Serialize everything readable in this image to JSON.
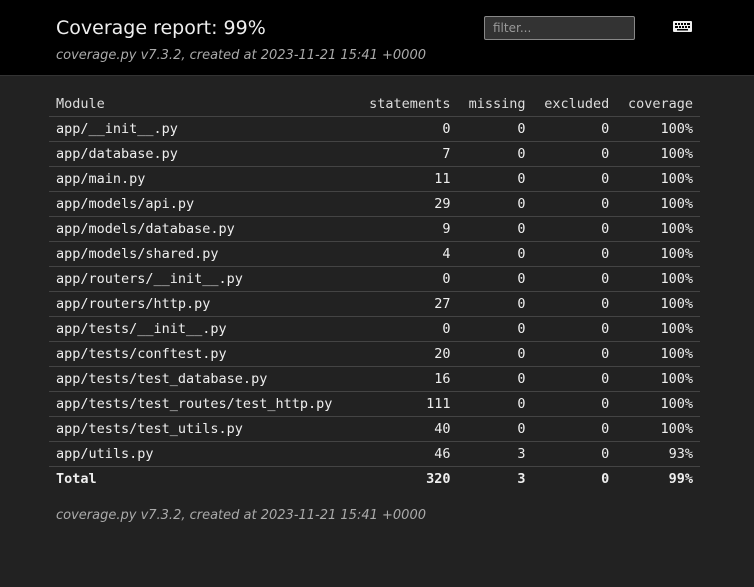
{
  "header": {
    "title": "Coverage report: 99%",
    "created": "coverage.py v7.3.2, created at 2023-11-21 15:41 +0000",
    "filter_placeholder": "filter...",
    "keyboard_icon": "keyboard-icon"
  },
  "table": {
    "columns": {
      "module": "Module",
      "statements": "statements",
      "missing": "missing",
      "excluded": "excluded",
      "coverage": "coverage"
    },
    "rows": [
      {
        "name": "app/__init__.py",
        "statements": "0",
        "missing": "0",
        "excluded": "0",
        "coverage": "100%"
      },
      {
        "name": "app/database.py",
        "statements": "7",
        "missing": "0",
        "excluded": "0",
        "coverage": "100%"
      },
      {
        "name": "app/main.py",
        "statements": "11",
        "missing": "0",
        "excluded": "0",
        "coverage": "100%"
      },
      {
        "name": "app/models/api.py",
        "statements": "29",
        "missing": "0",
        "excluded": "0",
        "coverage": "100%"
      },
      {
        "name": "app/models/database.py",
        "statements": "9",
        "missing": "0",
        "excluded": "0",
        "coverage": "100%"
      },
      {
        "name": "app/models/shared.py",
        "statements": "4",
        "missing": "0",
        "excluded": "0",
        "coverage": "100%"
      },
      {
        "name": "app/routers/__init__.py",
        "statements": "0",
        "missing": "0",
        "excluded": "0",
        "coverage": "100%"
      },
      {
        "name": "app/routers/http.py",
        "statements": "27",
        "missing": "0",
        "excluded": "0",
        "coverage": "100%"
      },
      {
        "name": "app/tests/__init__.py",
        "statements": "0",
        "missing": "0",
        "excluded": "0",
        "coverage": "100%"
      },
      {
        "name": "app/tests/conftest.py",
        "statements": "20",
        "missing": "0",
        "excluded": "0",
        "coverage": "100%"
      },
      {
        "name": "app/tests/test_database.py",
        "statements": "16",
        "missing": "0",
        "excluded": "0",
        "coverage": "100%"
      },
      {
        "name": "app/tests/test_routes/test_http.py",
        "statements": "111",
        "missing": "0",
        "excluded": "0",
        "coverage": "100%"
      },
      {
        "name": "app/tests/test_utils.py",
        "statements": "40",
        "missing": "0",
        "excluded": "0",
        "coverage": "100%"
      },
      {
        "name": "app/utils.py",
        "statements": "46",
        "missing": "3",
        "excluded": "0",
        "coverage": "93%"
      }
    ],
    "total": {
      "name": "Total",
      "statements": "320",
      "missing": "3",
      "excluded": "0",
      "coverage": "99%"
    }
  },
  "footer": {
    "created": "coverage.py v7.3.2, created at 2023-11-21 15:41 +0000"
  },
  "colors": {
    "background": "#222222",
    "header_background": "#000000",
    "text": "#eeeeee",
    "muted_text": "#aaaaaa"
  }
}
